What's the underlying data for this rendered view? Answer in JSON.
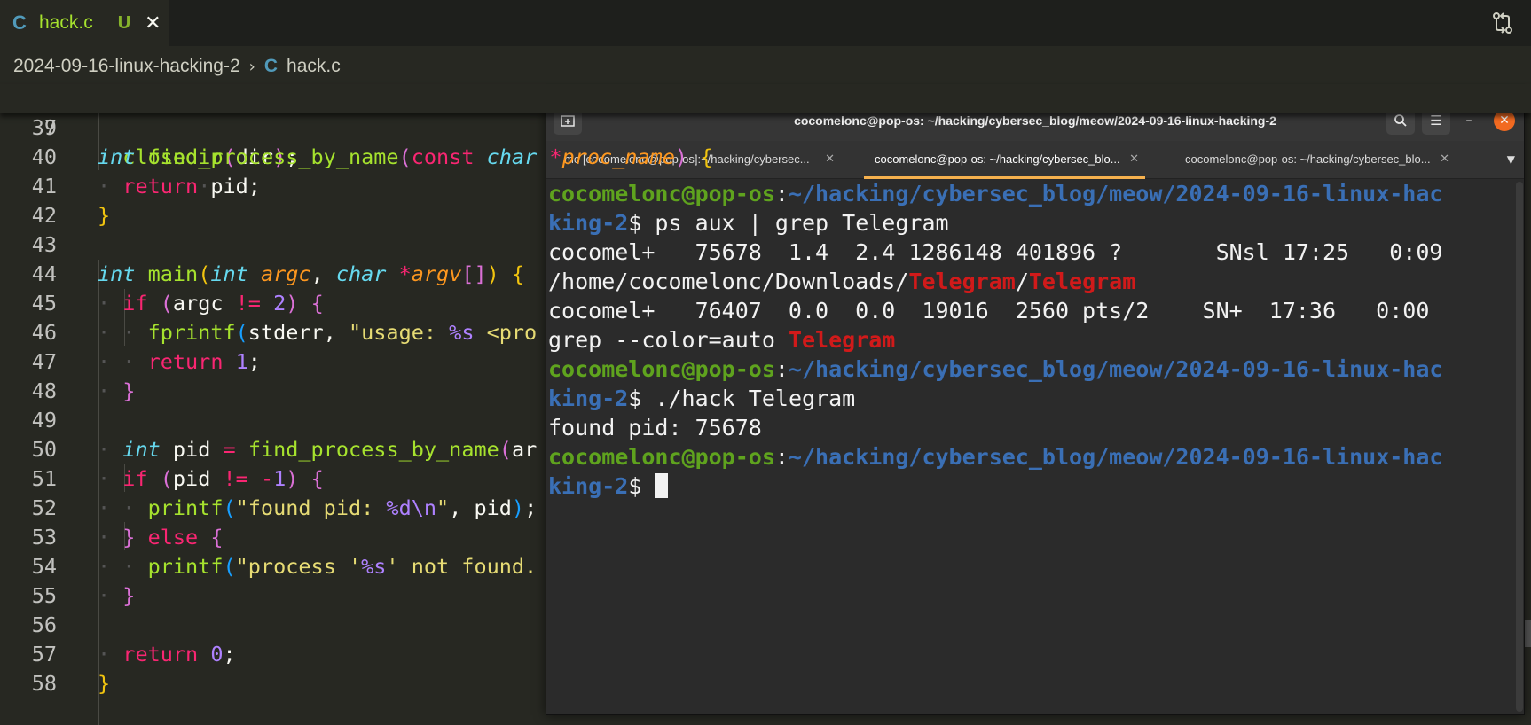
{
  "editor": {
    "tab": {
      "icon": "c-file-icon",
      "filename": "hack.c",
      "status": "U"
    },
    "breadcrumb": {
      "folder": "2024-09-16-linux-hacking-2",
      "file": "hack.c"
    },
    "sticky_line": {
      "number": "7"
    },
    "line_numbers": [
      "39",
      "40",
      "41",
      "42",
      "43",
      "44",
      "45",
      "46",
      "47",
      "48",
      "49",
      "50",
      "51",
      "52",
      "53",
      "54",
      "55",
      "56",
      "57",
      "58"
    ]
  },
  "terminal": {
    "title": "cocomelonc@pop-os: ~/hacking/cybersec_blog/meow/2024-09-16-linux-hacking-2",
    "tabs": [
      "mc [cocomelonc@pop-os]:~/hacking/cybersec...",
      "cocomelonc@pop-os: ~/hacking/cybersec_blo...",
      "cocomelonc@pop-os: ~/hacking/cybersec_blo..."
    ],
    "prompt_user": "cocomelonc@pop-os",
    "prompt_path_1": "~/hacking/cybersec_blog/meow/2024-09-16-linux-hac",
    "prompt_path_2": "king-2",
    "cmd1": " ps aux | grep Telegram",
    "ps1a": "cocomel+   75678  1.4  2.4 1286148 401896 ?       SNsl 17:25   0:09",
    "ps1b_pre": "/home/cocomelonc/Downloads/",
    "ps1b_hl1": "Telegram",
    "ps1b_sep": "/",
    "ps1b_hl2": "Telegram",
    "ps2a": "cocomel+   76407  0.0  0.0  19016  2560 pts/2    SN+  17:36   0:00",
    "ps2b_pre": "grep --color=auto ",
    "ps2b_hl": "Telegram",
    "cmd2": " ./hack Telegram",
    "out": "found pid: 75678",
    "colors": {
      "user": "#5fa31e",
      "path": "#3a6fb5",
      "match": "#d11a1a",
      "active_tab": "#f6b14e"
    }
  }
}
